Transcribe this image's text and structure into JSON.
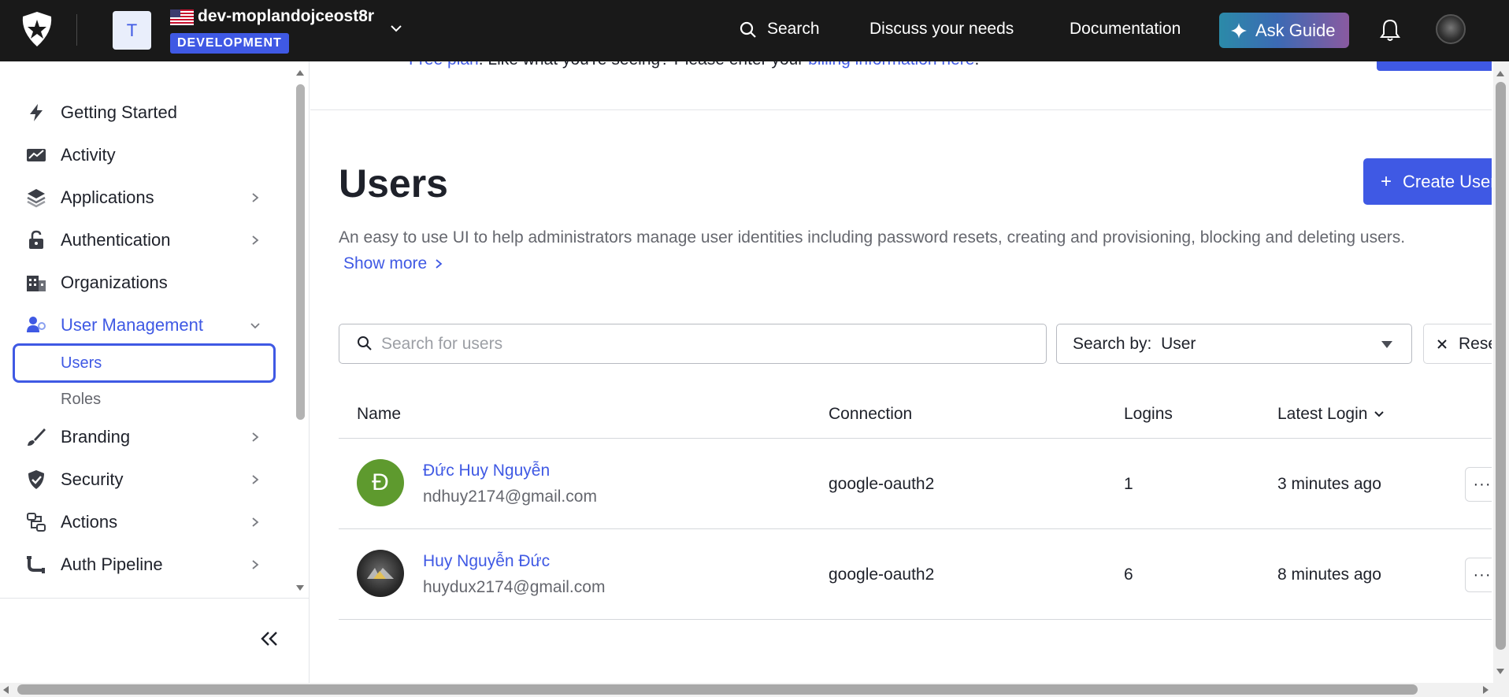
{
  "header": {
    "tenant_initial": "T",
    "tenant_name": "dev-moplandojceost8r",
    "environment": "DEVELOPMENT",
    "search_label": "Search",
    "discuss_label": "Discuss your needs",
    "docs_label": "Documentation",
    "ask_guide_label": "Ask Guide"
  },
  "sidebar": {
    "items": [
      {
        "label": "Getting Started",
        "icon": "lightning-icon",
        "chevron": false
      },
      {
        "label": "Activity",
        "icon": "activity-chart-icon",
        "chevron": false
      },
      {
        "label": "Applications",
        "icon": "layers-icon",
        "chevron": true
      },
      {
        "label": "Authentication",
        "icon": "lock-icon",
        "chevron": true
      },
      {
        "label": "Organizations",
        "icon": "building-icon",
        "chevron": false
      },
      {
        "label": "User Management",
        "icon": "users-gear-icon",
        "chevron": true,
        "expanded": true,
        "active": true
      },
      {
        "label": "Branding",
        "icon": "brush-icon",
        "chevron": true
      },
      {
        "label": "Security",
        "icon": "shield-check-icon",
        "chevron": true
      },
      {
        "label": "Actions",
        "icon": "flow-icon",
        "chevron": true
      },
      {
        "label": "Auth Pipeline",
        "icon": "pipe-icon",
        "chevron": true
      }
    ],
    "subitems": [
      {
        "label": "Users",
        "selected": true
      },
      {
        "label": "Roles",
        "selected": false
      }
    ]
  },
  "banner": {
    "link1": "Free plan",
    "text": ". Like what you're seeing? Please enter your ",
    "link2": "billing information here",
    "end": "."
  },
  "page": {
    "title": "Users",
    "create_button": "Create User",
    "description": "An easy to use UI to help administrators manage user identities including password resets, creating and provisioning, blocking and deleting users.",
    "show_more": "Show more"
  },
  "filters": {
    "search_placeholder": "Search for users",
    "search_by_label": "Search by:",
    "search_by_value": "User",
    "reset_label": "Reset"
  },
  "table": {
    "columns": [
      "Name",
      "Connection",
      "Logins",
      "Latest Login"
    ],
    "rows": [
      {
        "avatar_letter": "Đ",
        "avatar_color": "#5e9a2e",
        "name": "Đức Huy Nguyễn",
        "email": "ndhuy2174@gmail.com",
        "connection": "google-oauth2",
        "logins": "1",
        "latest_login": "3 minutes ago"
      },
      {
        "avatar_letter": "",
        "avatar_color": "#2b2b2b",
        "name": "Huy Nguyễn Đức",
        "email": "huydux2174@gmail.com",
        "connection": "google-oauth2",
        "logins": "6",
        "latest_login": "8 minutes ago"
      }
    ],
    "row_menu": "···"
  },
  "colors": {
    "accent": "#3f59e4",
    "topbar": "#191919",
    "text": "#1e212a",
    "muted": "#65676e"
  }
}
